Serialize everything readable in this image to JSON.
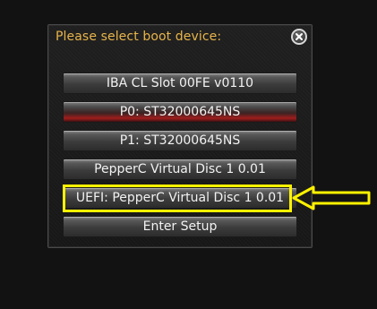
{
  "dialog": {
    "title": "Please select boot device:",
    "close_icon": "close-circle-icon"
  },
  "boot_options": [
    {
      "label": "IBA CL Slot 00FE v0110",
      "selected": false
    },
    {
      "label": "P0: ST32000645NS",
      "selected": true
    },
    {
      "label": "P1: ST32000645NS",
      "selected": false
    },
    {
      "label": "PepperC Virtual Disc 1 0.01",
      "selected": false
    },
    {
      "label": "UEFI: PepperC Virtual Disc 1 0.01",
      "selected": false
    },
    {
      "label": "Enter Setup",
      "selected": false
    }
  ],
  "annotation": {
    "highlight_color": "#fff200",
    "target": "UEFI: PepperC Virtual Disc 1 0.01"
  },
  "colors": {
    "title": "#e8b44a",
    "selected_accent": "#a01e1e",
    "background": "#121212"
  }
}
